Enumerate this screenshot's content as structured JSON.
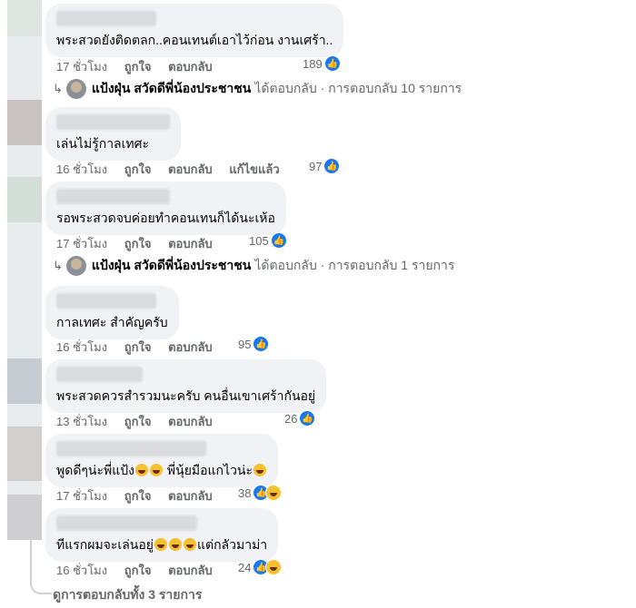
{
  "comments": [
    {
      "text": "พระสวดยังติดตลก..คอนเทนต์เอาไว้ก่อน งานเศร้า..",
      "age": "17 ชั่วโมง",
      "like": "ถูกใจ",
      "reply": "ตอบกลับ",
      "edited": "",
      "count": "189",
      "haha": false
    },
    {
      "text": "เล่นไม่รู้กาลเทศะ",
      "age": "16 ชั่วโมง",
      "like": "ถูกใจ",
      "reply": "ตอบกลับ",
      "edited": "แก้ไขแล้ว",
      "count": "97",
      "haha": false
    },
    {
      "text": "รอพระสวดจบค่อยทำคอนเทนก็ได้นะเห้อ",
      "age": "17 ชั่วโมง",
      "like": "ถูกใจ",
      "reply": "ตอบกลับ",
      "edited": "",
      "count": "105",
      "haha": false
    },
    {
      "text": "กาลเทศะ สำคัญครับ",
      "age": "16 ชั่วโมง",
      "like": "ถูกใจ",
      "reply": "ตอบกลับ",
      "edited": "",
      "count": "95",
      "haha": false
    },
    {
      "text": "พระสวดควรสำรวมนะครับ คนอื่นเขาเศร้ากันอยู่",
      "age": "13 ชั่วโมง",
      "like": "ถูกใจ",
      "reply": "ตอบกลับ",
      "edited": "",
      "count": "26",
      "haha": false
    },
    {
      "text_a": "พูดดีๆน่ะพี่แป้ง",
      "text_b": " พี่นุ้ยมือแกไวน่ะ",
      "age": "17 ชั่วโมง",
      "like": "ถูกใจ",
      "reply": "ตอบกลับ",
      "edited": "",
      "count": "38",
      "haha": true
    },
    {
      "text_a": "ทีแรกผมจะเล่นอยู่",
      "text_b": "แต่กลัวมาม่า",
      "age": "16 ชั่วโมง",
      "like": "ถูกใจ",
      "reply": "ตอบกลับ",
      "edited": "",
      "count": "24",
      "haha": true
    }
  ],
  "replies": [
    {
      "name": "แป้งฝุ่น สวัดดีพี่น้องประชาชน",
      "text": "ได้ตอบกลับ · การตอบกลับ 10 รายการ"
    },
    {
      "name": "แป้งฝุ่น สวัดดีพี่น้องประชาชน",
      "text": "ได้ตอบกลับ · การตอบกลับ 1 รายการ"
    }
  ],
  "view_all": "ดูการตอบกลับทั้ง 3 รายการ",
  "icons": {
    "like": "like-icon",
    "haha": "haha-icon",
    "reply_arrow": "reply-arrow-icon"
  },
  "colors": {
    "bubble": "#f0f2f5",
    "like_blue": "#1877f2",
    "meta_gray": "#65676b"
  }
}
